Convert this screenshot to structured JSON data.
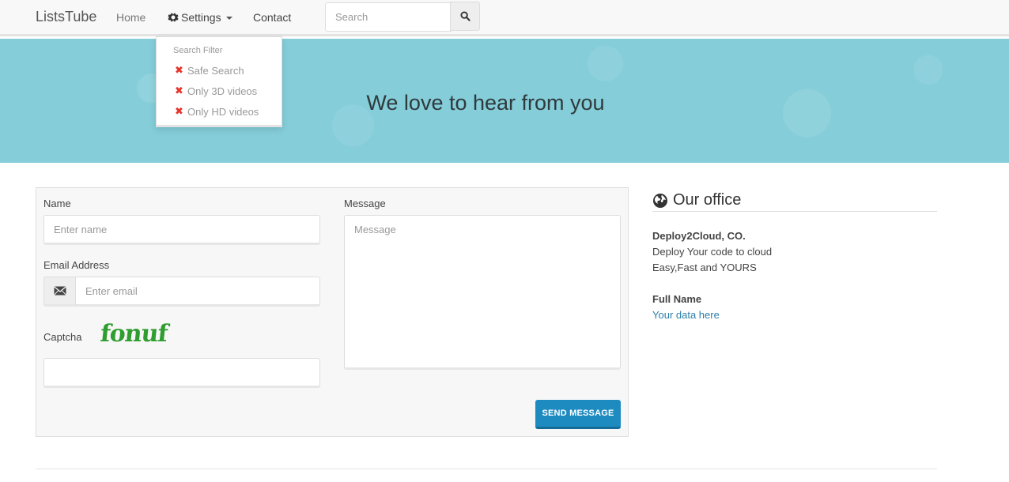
{
  "navbar": {
    "brand": "ListsTube",
    "home": "Home",
    "settings": "Settings",
    "contact": "Contact",
    "search_placeholder": "Search"
  },
  "dropdown": {
    "header": "Search Filter",
    "items": [
      {
        "label": "Safe Search",
        "checked": false
      },
      {
        "label": "Only 3D videos",
        "checked": false
      },
      {
        "label": "Only HD videos",
        "checked": false
      }
    ]
  },
  "hero": {
    "title": "We love to hear from you",
    "bg_color": "#84cdd9"
  },
  "form": {
    "name_label": "Name",
    "name_placeholder": "Enter name",
    "email_label": "Email Address",
    "email_placeholder": "Enter email",
    "captcha_label": "Captcha",
    "captcha_text": "fonuf",
    "message_label": "Message",
    "message_placeholder": "Message",
    "send_button": "SEND MESSAGE"
  },
  "office": {
    "title": "Our office",
    "company": "Deploy2Cloud, CO.",
    "line1": "Deploy Your code to cloud",
    "line2": "Easy,Fast and YOURS",
    "fullname_label": "Full Name",
    "fullname_value": "Your data here"
  },
  "colors": {
    "accent": "#1d8ac0",
    "captcha": "#2f9d2f",
    "unchecked": "#e8332a"
  }
}
